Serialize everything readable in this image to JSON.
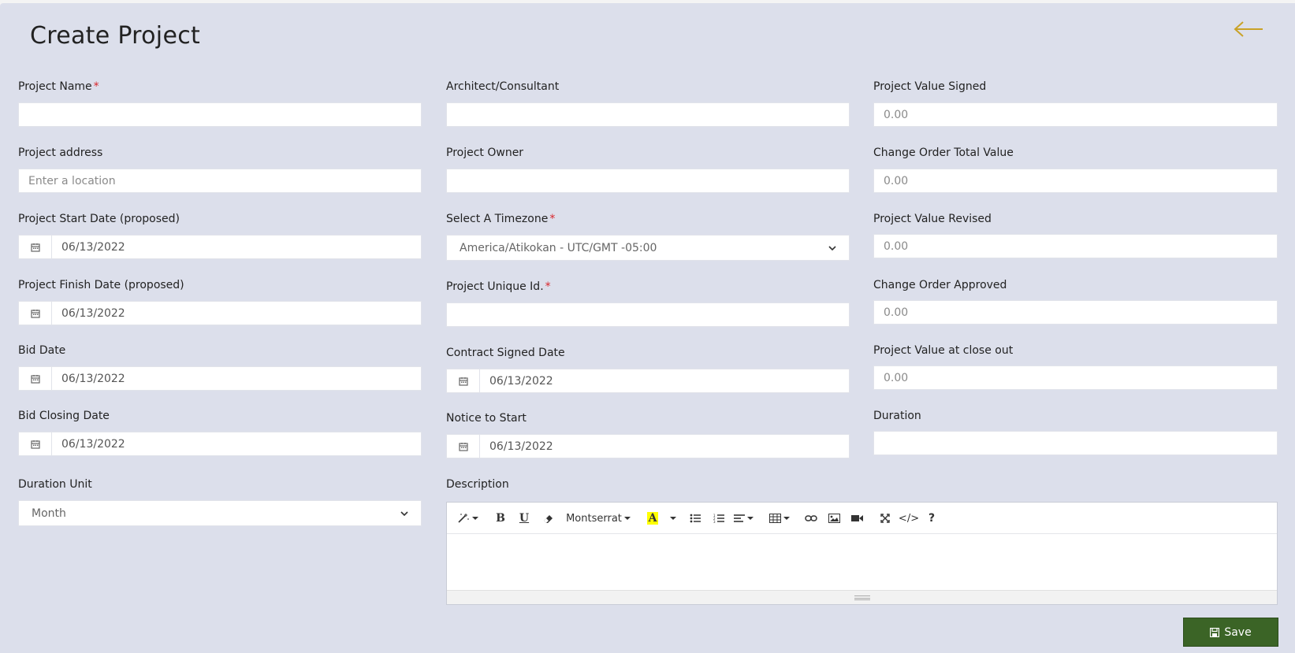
{
  "page": {
    "title": "Create Project",
    "back_icon": "arrow-left-icon",
    "accent_color": "#c9a227"
  },
  "fields": {
    "project_name": {
      "label": "Project Name",
      "required": "*",
      "value": ""
    },
    "project_address": {
      "label": "Project address",
      "placeholder": "Enter a location"
    },
    "start_date": {
      "label": "Project Start Date (proposed)",
      "value": "06/13/2022"
    },
    "finish_date": {
      "label": "Project Finish Date (proposed)",
      "value": "06/13/2022"
    },
    "bid_date": {
      "label": "Bid Date",
      "value": "06/13/2022"
    },
    "bid_closing_date": {
      "label": "Bid Closing Date",
      "value": "06/13/2022"
    },
    "duration_unit": {
      "label": "Duration Unit",
      "value": "Month"
    },
    "architect": {
      "label": "Architect/Consultant",
      "value": ""
    },
    "project_owner": {
      "label": "Project Owner",
      "value": ""
    },
    "timezone": {
      "label": "Select A Timezone",
      "required": "*",
      "value": "America/Atikokan - UTC/GMT -05:00"
    },
    "unique_id": {
      "label": "Project Unique Id.",
      "required": "*",
      "value": ""
    },
    "contract_signed_date": {
      "label": "Contract Signed Date",
      "value": "06/13/2022"
    },
    "notice_to_start": {
      "label": "Notice to Start",
      "value": "06/13/2022"
    },
    "description": {
      "label": "Description"
    },
    "value_signed": {
      "label": "Project Value Signed",
      "placeholder": "0.00"
    },
    "change_order_total": {
      "label": "Change Order Total Value",
      "placeholder": "0.00"
    },
    "value_revised": {
      "label": "Project Value Revised",
      "placeholder": "0.00"
    },
    "change_order_approved": {
      "label": "Change Order Approved",
      "placeholder": "0.00"
    },
    "value_close_out": {
      "label": "Project Value at close out",
      "placeholder": "0.00"
    },
    "duration": {
      "label": "Duration",
      "value": ""
    }
  },
  "editor": {
    "font_name": "Montserrat",
    "tools": [
      "magic-icon",
      "bold-icon",
      "underline-icon",
      "eraser-icon",
      "font-family-dropdown",
      "highlight-icon",
      "unordered-list-icon",
      "ordered-list-icon",
      "align-icon",
      "table-icon",
      "link-icon",
      "picture-icon",
      "video-icon",
      "fullscreen-icon",
      "code-view-icon",
      "help-icon"
    ],
    "bold_glyph": "B",
    "underline_glyph": "U",
    "highlight_glyph": "A",
    "help_glyph": "?",
    "code_glyph": "</>",
    "highlight_color": "#ffff00"
  },
  "actions": {
    "save_label": "Save",
    "save_color": "#3b6426"
  }
}
